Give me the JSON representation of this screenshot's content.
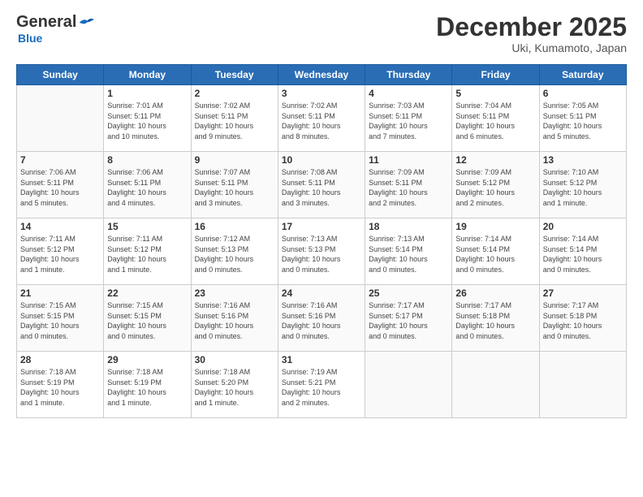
{
  "header": {
    "logo_general": "General",
    "logo_blue": "Blue",
    "month_title": "December 2025",
    "location": "Uki, Kumamoto, Japan"
  },
  "days_of_week": [
    "Sunday",
    "Monday",
    "Tuesday",
    "Wednesday",
    "Thursday",
    "Friday",
    "Saturday"
  ],
  "weeks": [
    [
      {
        "day": "",
        "info": ""
      },
      {
        "day": "1",
        "info": "Sunrise: 7:01 AM\nSunset: 5:11 PM\nDaylight: 10 hours\nand 10 minutes."
      },
      {
        "day": "2",
        "info": "Sunrise: 7:02 AM\nSunset: 5:11 PM\nDaylight: 10 hours\nand 9 minutes."
      },
      {
        "day": "3",
        "info": "Sunrise: 7:02 AM\nSunset: 5:11 PM\nDaylight: 10 hours\nand 8 minutes."
      },
      {
        "day": "4",
        "info": "Sunrise: 7:03 AM\nSunset: 5:11 PM\nDaylight: 10 hours\nand 7 minutes."
      },
      {
        "day": "5",
        "info": "Sunrise: 7:04 AM\nSunset: 5:11 PM\nDaylight: 10 hours\nand 6 minutes."
      },
      {
        "day": "6",
        "info": "Sunrise: 7:05 AM\nSunset: 5:11 PM\nDaylight: 10 hours\nand 5 minutes."
      }
    ],
    [
      {
        "day": "7",
        "info": "Sunrise: 7:06 AM\nSunset: 5:11 PM\nDaylight: 10 hours\nand 5 minutes."
      },
      {
        "day": "8",
        "info": "Sunrise: 7:06 AM\nSunset: 5:11 PM\nDaylight: 10 hours\nand 4 minutes."
      },
      {
        "day": "9",
        "info": "Sunrise: 7:07 AM\nSunset: 5:11 PM\nDaylight: 10 hours\nand 3 minutes."
      },
      {
        "day": "10",
        "info": "Sunrise: 7:08 AM\nSunset: 5:11 PM\nDaylight: 10 hours\nand 3 minutes."
      },
      {
        "day": "11",
        "info": "Sunrise: 7:09 AM\nSunset: 5:11 PM\nDaylight: 10 hours\nand 2 minutes."
      },
      {
        "day": "12",
        "info": "Sunrise: 7:09 AM\nSunset: 5:12 PM\nDaylight: 10 hours\nand 2 minutes."
      },
      {
        "day": "13",
        "info": "Sunrise: 7:10 AM\nSunset: 5:12 PM\nDaylight: 10 hours\nand 1 minute."
      }
    ],
    [
      {
        "day": "14",
        "info": "Sunrise: 7:11 AM\nSunset: 5:12 PM\nDaylight: 10 hours\nand 1 minute."
      },
      {
        "day": "15",
        "info": "Sunrise: 7:11 AM\nSunset: 5:12 PM\nDaylight: 10 hours\nand 1 minute."
      },
      {
        "day": "16",
        "info": "Sunrise: 7:12 AM\nSunset: 5:13 PM\nDaylight: 10 hours\nand 0 minutes."
      },
      {
        "day": "17",
        "info": "Sunrise: 7:13 AM\nSunset: 5:13 PM\nDaylight: 10 hours\nand 0 minutes."
      },
      {
        "day": "18",
        "info": "Sunrise: 7:13 AM\nSunset: 5:14 PM\nDaylight: 10 hours\nand 0 minutes."
      },
      {
        "day": "19",
        "info": "Sunrise: 7:14 AM\nSunset: 5:14 PM\nDaylight: 10 hours\nand 0 minutes."
      },
      {
        "day": "20",
        "info": "Sunrise: 7:14 AM\nSunset: 5:14 PM\nDaylight: 10 hours\nand 0 minutes."
      }
    ],
    [
      {
        "day": "21",
        "info": "Sunrise: 7:15 AM\nSunset: 5:15 PM\nDaylight: 10 hours\nand 0 minutes."
      },
      {
        "day": "22",
        "info": "Sunrise: 7:15 AM\nSunset: 5:15 PM\nDaylight: 10 hours\nand 0 minutes."
      },
      {
        "day": "23",
        "info": "Sunrise: 7:16 AM\nSunset: 5:16 PM\nDaylight: 10 hours\nand 0 minutes."
      },
      {
        "day": "24",
        "info": "Sunrise: 7:16 AM\nSunset: 5:16 PM\nDaylight: 10 hours\nand 0 minutes."
      },
      {
        "day": "25",
        "info": "Sunrise: 7:17 AM\nSunset: 5:17 PM\nDaylight: 10 hours\nand 0 minutes."
      },
      {
        "day": "26",
        "info": "Sunrise: 7:17 AM\nSunset: 5:18 PM\nDaylight: 10 hours\nand 0 minutes."
      },
      {
        "day": "27",
        "info": "Sunrise: 7:17 AM\nSunset: 5:18 PM\nDaylight: 10 hours\nand 0 minutes."
      }
    ],
    [
      {
        "day": "28",
        "info": "Sunrise: 7:18 AM\nSunset: 5:19 PM\nDaylight: 10 hours\nand 1 minute."
      },
      {
        "day": "29",
        "info": "Sunrise: 7:18 AM\nSunset: 5:19 PM\nDaylight: 10 hours\nand 1 minute."
      },
      {
        "day": "30",
        "info": "Sunrise: 7:18 AM\nSunset: 5:20 PM\nDaylight: 10 hours\nand 1 minute."
      },
      {
        "day": "31",
        "info": "Sunrise: 7:19 AM\nSunset: 5:21 PM\nDaylight: 10 hours\nand 2 minutes."
      },
      {
        "day": "",
        "info": ""
      },
      {
        "day": "",
        "info": ""
      },
      {
        "day": "",
        "info": ""
      }
    ]
  ]
}
